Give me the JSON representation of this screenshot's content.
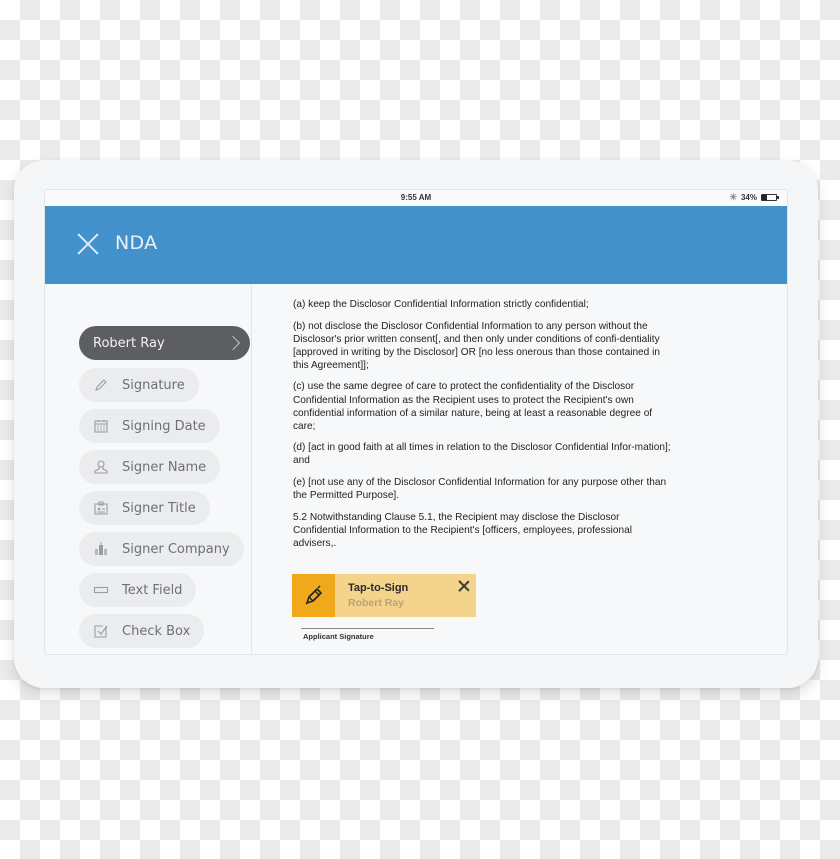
{
  "status_bar": {
    "time": "9:55 AM",
    "battery_text": "34%",
    "battery_level": 0.34,
    "bluetooth_icon": "bluetooth-icon",
    "battery_icon": "battery-icon"
  },
  "header": {
    "title": "NDA",
    "close_icon": "close-icon",
    "color": "#4391cb"
  },
  "sidebar": {
    "signer": {
      "label": "Robert Ray",
      "icon": "chevron-right-icon"
    },
    "fields": [
      {
        "label": "Signature",
        "icon": "pencil-icon"
      },
      {
        "label": "Signing Date",
        "icon": "calendar-icon"
      },
      {
        "label": "Signer Name",
        "icon": "person-icon"
      },
      {
        "label": "Signer Title",
        "icon": "id-badge-icon"
      },
      {
        "label": "Signer Company",
        "icon": "building-icon"
      },
      {
        "label": "Text Field",
        "icon": "text-field-icon"
      },
      {
        "label": "Check Box",
        "icon": "checkbox-icon"
      }
    ]
  },
  "document": {
    "paragraphs": [
      "(a)  keep the Disclosor Confidential Information strictly confidential;",
      "(b)  not disclose the Disclosor Confidential Information to any person without the Disclosor's prior written consent[, and then only under conditions of confi-dentiality [approved in writing by the Disclosor] OR [no less onerous than those contained in this Agreement]];",
      "(c)  use the same degree of care to protect the confidentiality of the Disclosor Confidential Information as the Recipient uses to protect the Recipient's own confidential information of a similar nature, being at least a reasonable degree of care;",
      "(d)  [act in good faith at all times in relation to the Disclosor Confidential Infor-mation]; and",
      "(e)  [not use any of the Disclosor Confidential Information for any purpose other than the Permitted Purpose].",
      "5.2  Notwithstanding Clause 5.1, the Recipient may disclose the Disclosor Confidential Information to the Recipient's [officers, employees, professional advisers,."
    ],
    "sign_field": {
      "title": "Tap-to-Sign",
      "signer": "Robert Ray",
      "icon": "pen-icon",
      "accent": "#f0a91b",
      "background": "#f4d38a"
    },
    "signature_label": "Applicant Signature"
  }
}
